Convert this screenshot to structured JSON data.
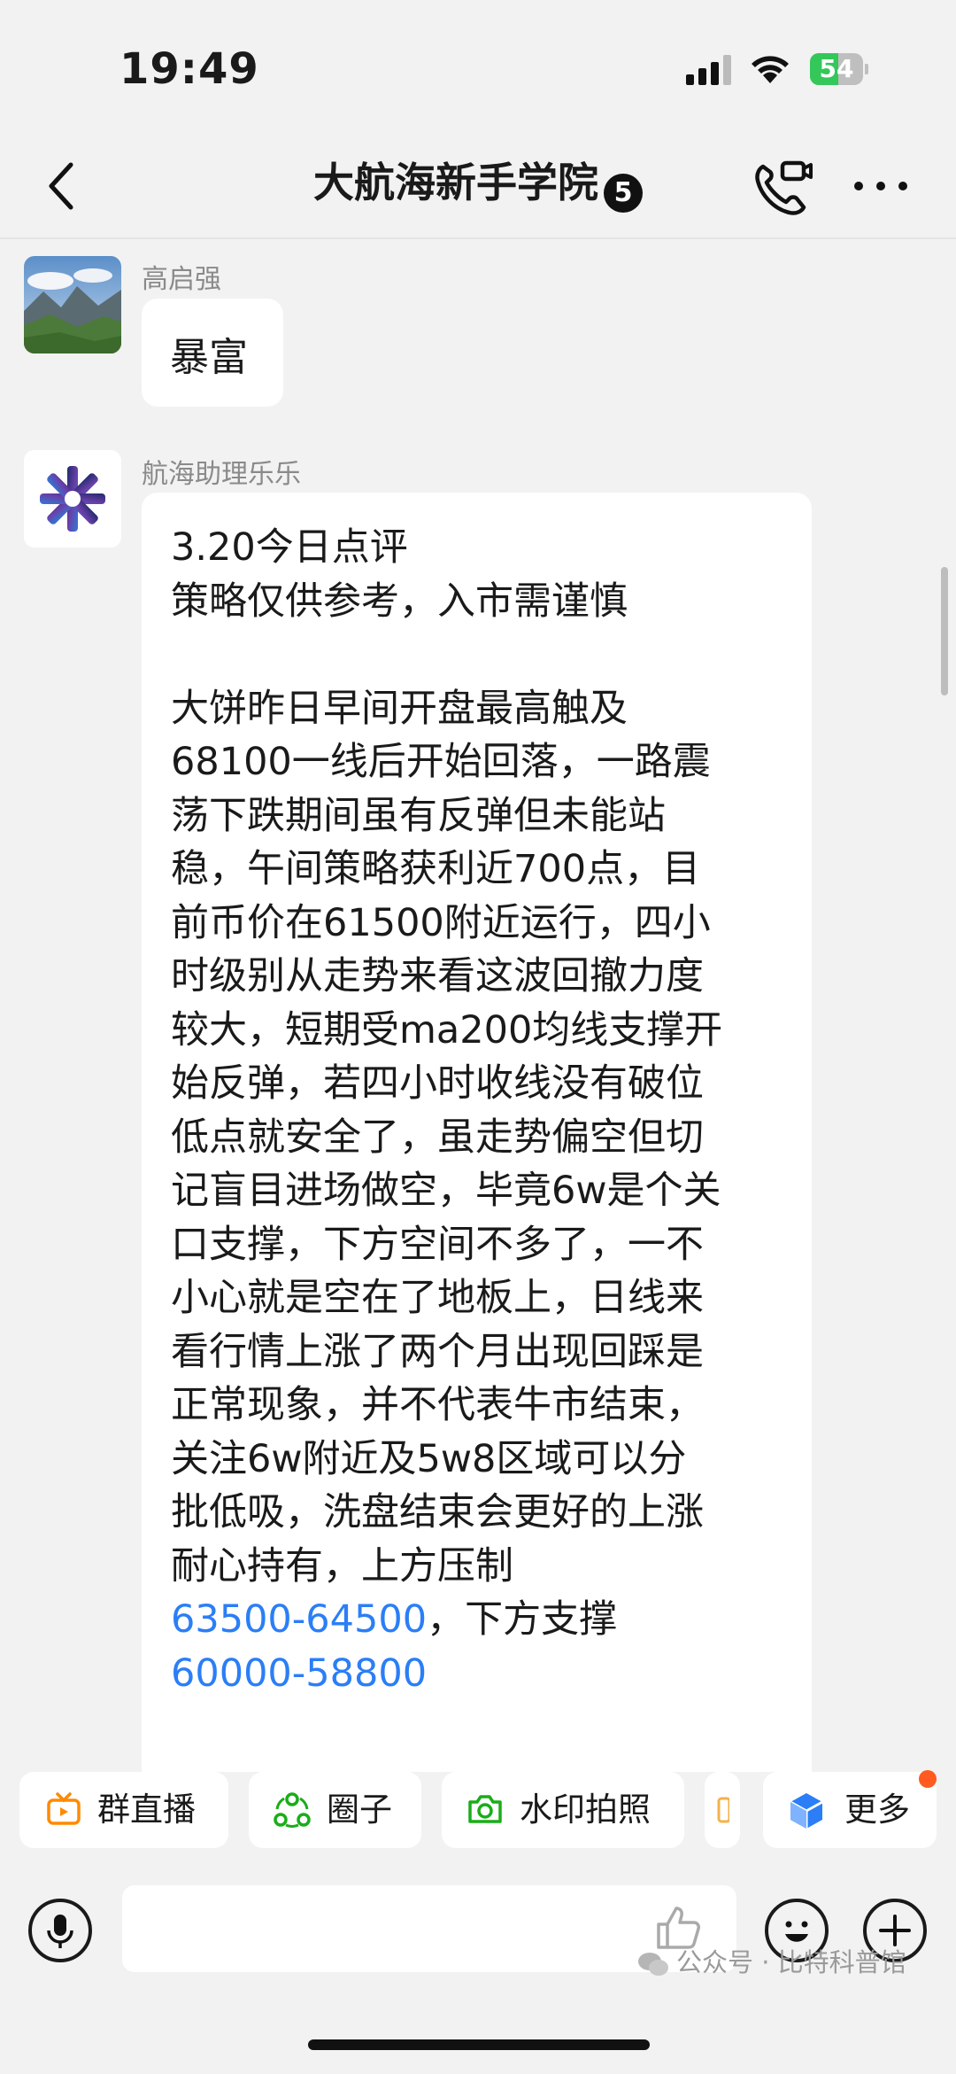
{
  "status_bar": {
    "time": "19:49",
    "battery": "54",
    "battery_level": 0.54
  },
  "header": {
    "title": "大航海新手学院",
    "badge": "5"
  },
  "messages": [
    {
      "sender": "高启强",
      "text": "暴富"
    },
    {
      "sender": "航海助理乐乐",
      "lines": [
        "3.20今日点评",
        "策略仅供参考，入市需谨慎",
        "",
        "大饼昨日早间开盘最高触及",
        "68100一线后开始回落，一路震",
        "荡下跌期间虽有反弹但未能站",
        "稳，午间策略获利近700点，目",
        "前币价在61500附近运行，四小",
        "时级别从走势来看这波回撤力度",
        "较大，短期受ma200均线支撑开",
        "始反弹，若四小时收线没有破位",
        "低点就安全了，虽走势偏空但切",
        "记盲目进场做空，毕竟6w是个关",
        "口支撑，下方空间不多了，一不",
        "小心就是空在了地板上，日线来",
        "看行情上涨了两个月出现回踩是",
        "正常现象，并不代表牛市结束，",
        "关注6w附近及5w8区域可以分",
        "批低吸，洗盘结束会更好的上涨",
        "耐心持有，上方压制"
      ],
      "link_1": "63500-64500",
      "after_link_1": "，下方支撑",
      "link_2": "60000-58800"
    }
  ],
  "quick_actions": [
    {
      "label": "群直播",
      "icon": "tv-icon"
    },
    {
      "label": "圈子",
      "icon": "circle-group-icon"
    },
    {
      "label": "水印拍照",
      "icon": "camera-icon"
    },
    {
      "label": "更多",
      "icon": "cube-icon"
    }
  ],
  "watermark": "公众号 · 比特科普馆",
  "colors": {
    "link": "#2b7ef6",
    "accent_orange": "#ff8a00",
    "accent_green": "#1aad19",
    "notify_dot": "#ff5a1f"
  }
}
